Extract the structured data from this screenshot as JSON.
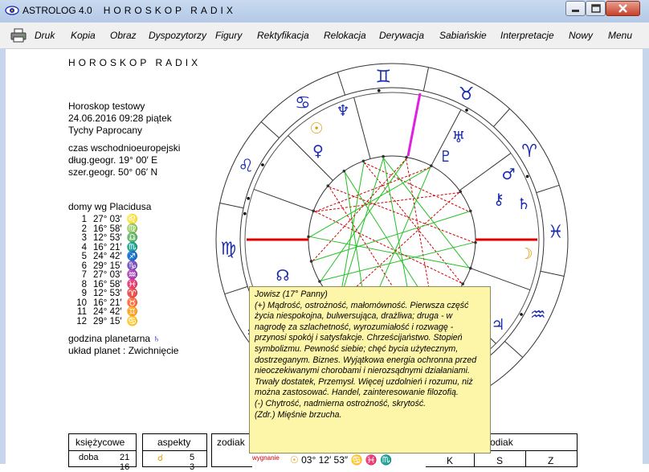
{
  "titlebar": {
    "app_name": "ASTROLOG 4.0",
    "window_title": "HOROSKOP RADIX"
  },
  "menu": [
    "Druk",
    "Kopia",
    "Obraz",
    "Dyspozytorzy",
    "Figury",
    "Rektyfikacja",
    "Relokacja",
    "Derywacja",
    "Sabiańskie",
    "Interpretacje",
    "Nowy",
    "Menu"
  ],
  "heading": "HOROSKOP RADIX",
  "info": {
    "name": "Horoskop testowy",
    "datetime": "24.06.2016  09:28  piątek",
    "place": "Tychy Paprocany",
    "timezone": "czas wschodnioeuropejski",
    "longitude": "dług.geogr.    19° 00′ E",
    "latitude": "szer.geogr.    50° 06′ N"
  },
  "houses_title": "domy wg Placidusa",
  "houses": [
    {
      "num": "1",
      "deg": "27° 03′",
      "sign": "♌"
    },
    {
      "num": "2",
      "deg": "16° 58′",
      "sign": "♍"
    },
    {
      "num": "3",
      "deg": "12° 53′",
      "sign": "♎"
    },
    {
      "num": "4",
      "deg": "16° 21′",
      "sign": "♏"
    },
    {
      "num": "5",
      "deg": "24° 42′",
      "sign": "♐"
    },
    {
      "num": "6",
      "deg": "29° 15′",
      "sign": "♑"
    },
    {
      "num": "7",
      "deg": "27° 03′",
      "sign": "♒"
    },
    {
      "num": "8",
      "deg": "16° 58′",
      "sign": "♓"
    },
    {
      "num": "9",
      "deg": "12° 53′",
      "sign": "♈"
    },
    {
      "num": "10",
      "deg": "16° 21′",
      "sign": "♉"
    },
    {
      "num": "11",
      "deg": "24° 42′",
      "sign": "♊"
    },
    {
      "num": "12",
      "deg": "29° 15′",
      "sign": "♋"
    }
  ],
  "planetary_hour": "godzina planetarna",
  "planetary_hour_glyph": "♄",
  "planet_layout": "układ planet : Zwichnięcie",
  "chart": {
    "signs": [
      "♊",
      "♉",
      "♈",
      "♓",
      "♒",
      "♑",
      "♐",
      "♏",
      "♎",
      "♍",
      "♌",
      "♋"
    ],
    "planets": [
      "♀",
      "☉",
      "♆",
      "♇",
      "♅",
      "⚷",
      "♂",
      "☽",
      "♄",
      "♃",
      "☊"
    ]
  },
  "tooltip": {
    "title": "Jowisz  (17° Panny)",
    "lines": [
      "(+) Mądrość, ostrożność, małomówność. Pierwsza część",
      "życia niespokojna, bulwersująca, drażliwa; druga - w",
      "nagrodę za szlachetność, wyrozumiałość i rozwagę -",
      "przynosi spokój i satysfakcje. Chrześcijaństwo. Stopień",
      "symbolizmu. Pewność siebie; chęć bycia użytecznym,",
      "dostrzeganym. Biznes. Wyjątkowa energia ochronna przed",
      "nieoczekiwanymi chorobami i nierozsądnymi działaniami.",
      "Trwały dostatek, Przemysł. Więcej uzdolnień i rozumu, niż",
      "można zastosować. Handel, zainteresowanie filozofią.",
      "(-) Chytrość, nadmierna ostrożność, skrytość.",
      "(Zdr.) Mięśnie brzucha."
    ]
  },
  "bottom": {
    "moon_header": "księżycowe",
    "moon_row_label": "doba",
    "moon_row_value": "21",
    "moon_row_value2": "16",
    "aspects_header": "aspekty",
    "aspects_values": [
      "5",
      "3"
    ],
    "zodiac_header": "zodiak",
    "zodiac_header2": "odiak",
    "wygnanie": "wygnanie",
    "position": "03° 12′ 53″",
    "ksz": [
      "K",
      "S",
      "Z"
    ]
  },
  "colors": {
    "wheel_blue": "#1a2bb0",
    "sun_orange": "#e09a00",
    "axis_red": "#e00000",
    "mc_magenta": "#e020e0",
    "aspect_green": "#22c022",
    "aspect_red": "#d00000",
    "tooltip_bg": "#fdf5a8"
  }
}
